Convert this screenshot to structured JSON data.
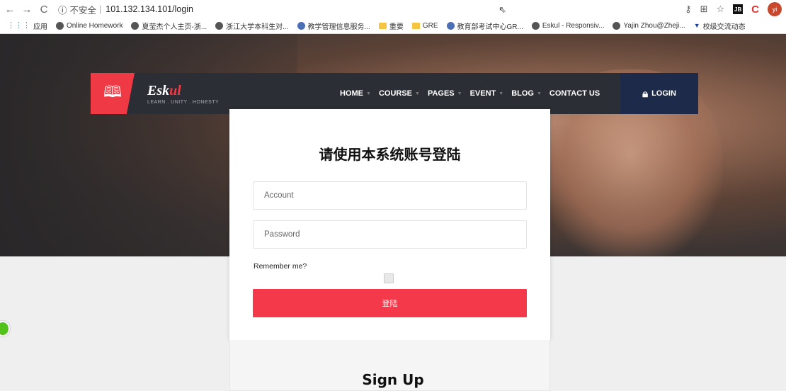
{
  "browser": {
    "url_secure_label": "不安全",
    "url": "101.132.134.101/login",
    "bookmarks": [
      {
        "label": "应用",
        "icon": "apps-grid-icon"
      },
      {
        "label": "Online Homework",
        "icon": "globe-icon"
      },
      {
        "label": "夏莹杰个人主页-浙...",
        "icon": "globe-icon"
      },
      {
        "label": "浙江大学本科生对...",
        "icon": "globe-icon"
      },
      {
        "label": "教学管理信息服务...",
        "icon": "globe-icon"
      },
      {
        "label": "重要",
        "icon": "folder-icon"
      },
      {
        "label": "GRE",
        "icon": "folder-icon"
      },
      {
        "label": "教育部考试中心GR...",
        "icon": "globe-icon"
      },
      {
        "label": "Eskul - Responsiv...",
        "icon": "globe-icon"
      },
      {
        "label": "Yajin Zhou@Zheji...",
        "icon": "globe-icon"
      },
      {
        "label": "校级交流动态",
        "icon": "triangle-icon"
      }
    ],
    "profile_initials": "yi"
  },
  "site": {
    "brand_first": "Esk",
    "brand_accent": "ul",
    "tagline": "LEARN . UNITY . HONESTY",
    "menu": [
      "HOME",
      "COURSE",
      "PAGES",
      "EVENT",
      "BLOG",
      "CONTACT US"
    ],
    "login_label": "LOGIN",
    "accent_color": "#ef3a45"
  },
  "modal": {
    "title": "请使用本系统账号登陆",
    "account_placeholder": "Account",
    "password_placeholder": "Password",
    "remember_label": "Remember me?",
    "submit_label": "登陆"
  },
  "signup": {
    "title": "Sign Up"
  }
}
